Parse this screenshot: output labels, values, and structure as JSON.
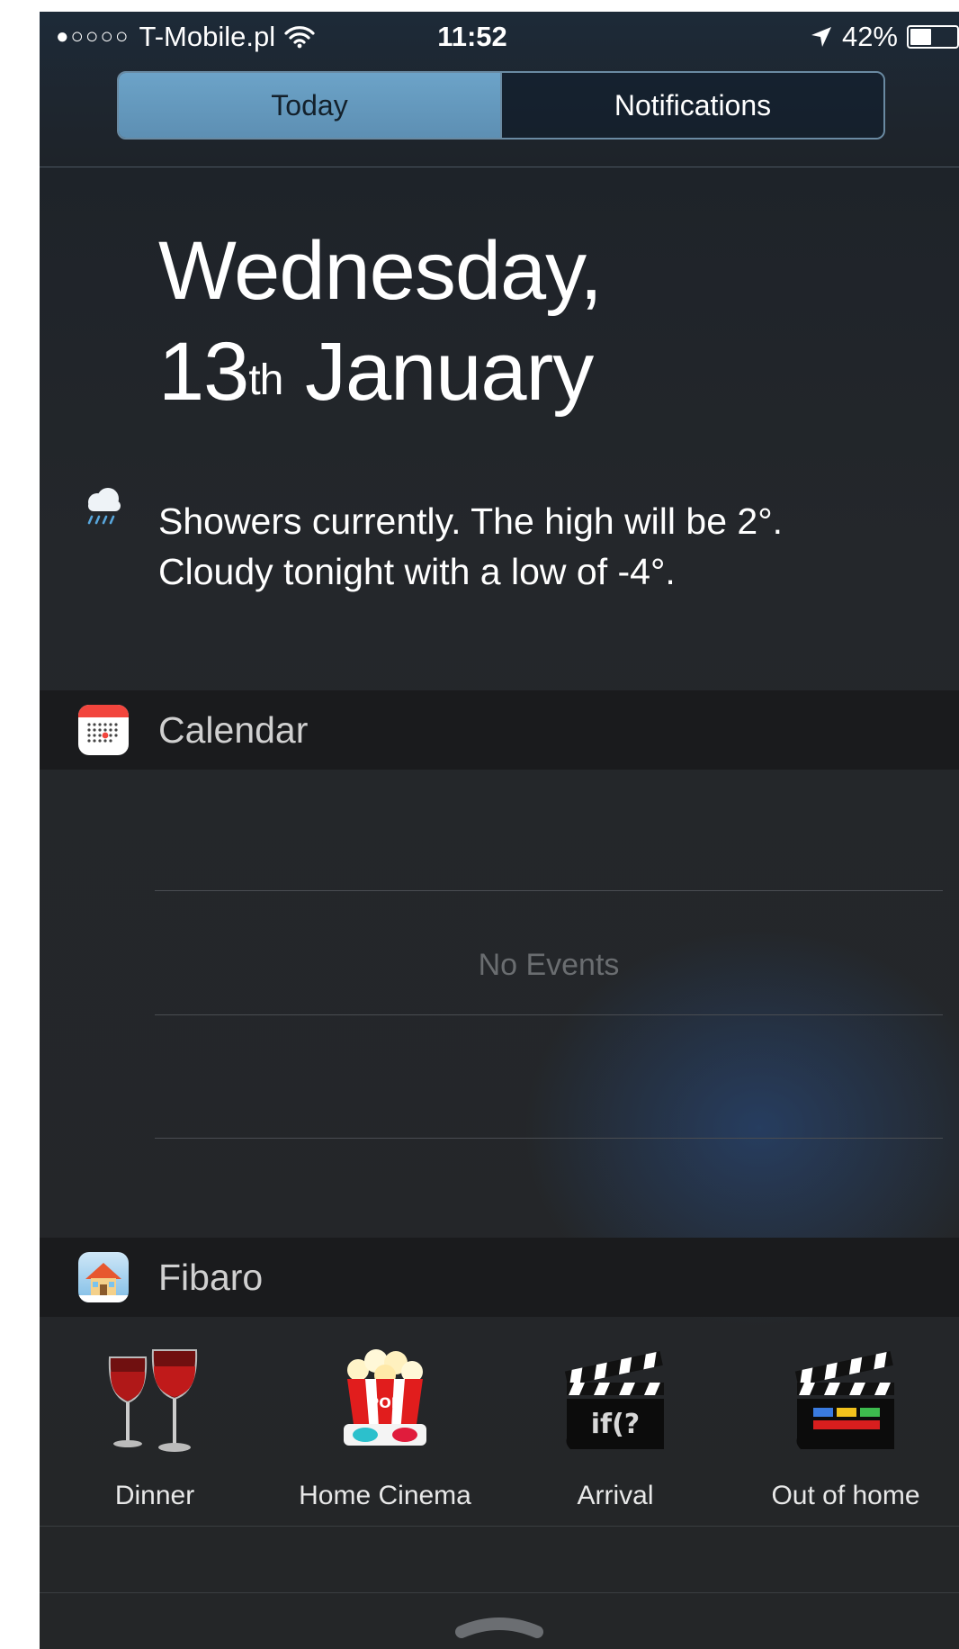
{
  "status_bar": {
    "signal_dots": "●○○○○",
    "carrier": "T-Mobile.pl",
    "time": "11:52",
    "battery_percent": "42%",
    "battery_level": 0.42,
    "icons": [
      "wifi-icon",
      "location-arrow-icon",
      "battery-icon"
    ]
  },
  "segments": [
    {
      "label": "Today",
      "selected": true
    },
    {
      "label": "Notifications",
      "selected": false
    }
  ],
  "date": {
    "line1": "Wednesday,",
    "day": "13",
    "suffix": "th",
    "month": "January"
  },
  "weather": {
    "icon": "rain-cloud-icon",
    "line1": "Showers currently. The high will be 2°.",
    "line2": "Cloudy tonight with a low of -4°."
  },
  "calendar": {
    "title": "Calendar",
    "icon": "calendar-app-icon",
    "empty_text": "No Events"
  },
  "fibaro": {
    "title": "Fibaro",
    "icon": "fibaro-app-icon",
    "scenes": [
      {
        "label": "Dinner",
        "icon": "wine-glasses-icon"
      },
      {
        "label": "Home Cinema",
        "icon": "popcorn-icon"
      },
      {
        "label": "Arrival",
        "icon": "clapperboard-if-icon"
      },
      {
        "label": "Out of home",
        "icon": "clapperboard-blocks-icon"
      }
    ]
  },
  "colors": {
    "segment_active": "#6ca3c8",
    "calendar_red": "#f2453d",
    "wine_red": "#a01010"
  }
}
